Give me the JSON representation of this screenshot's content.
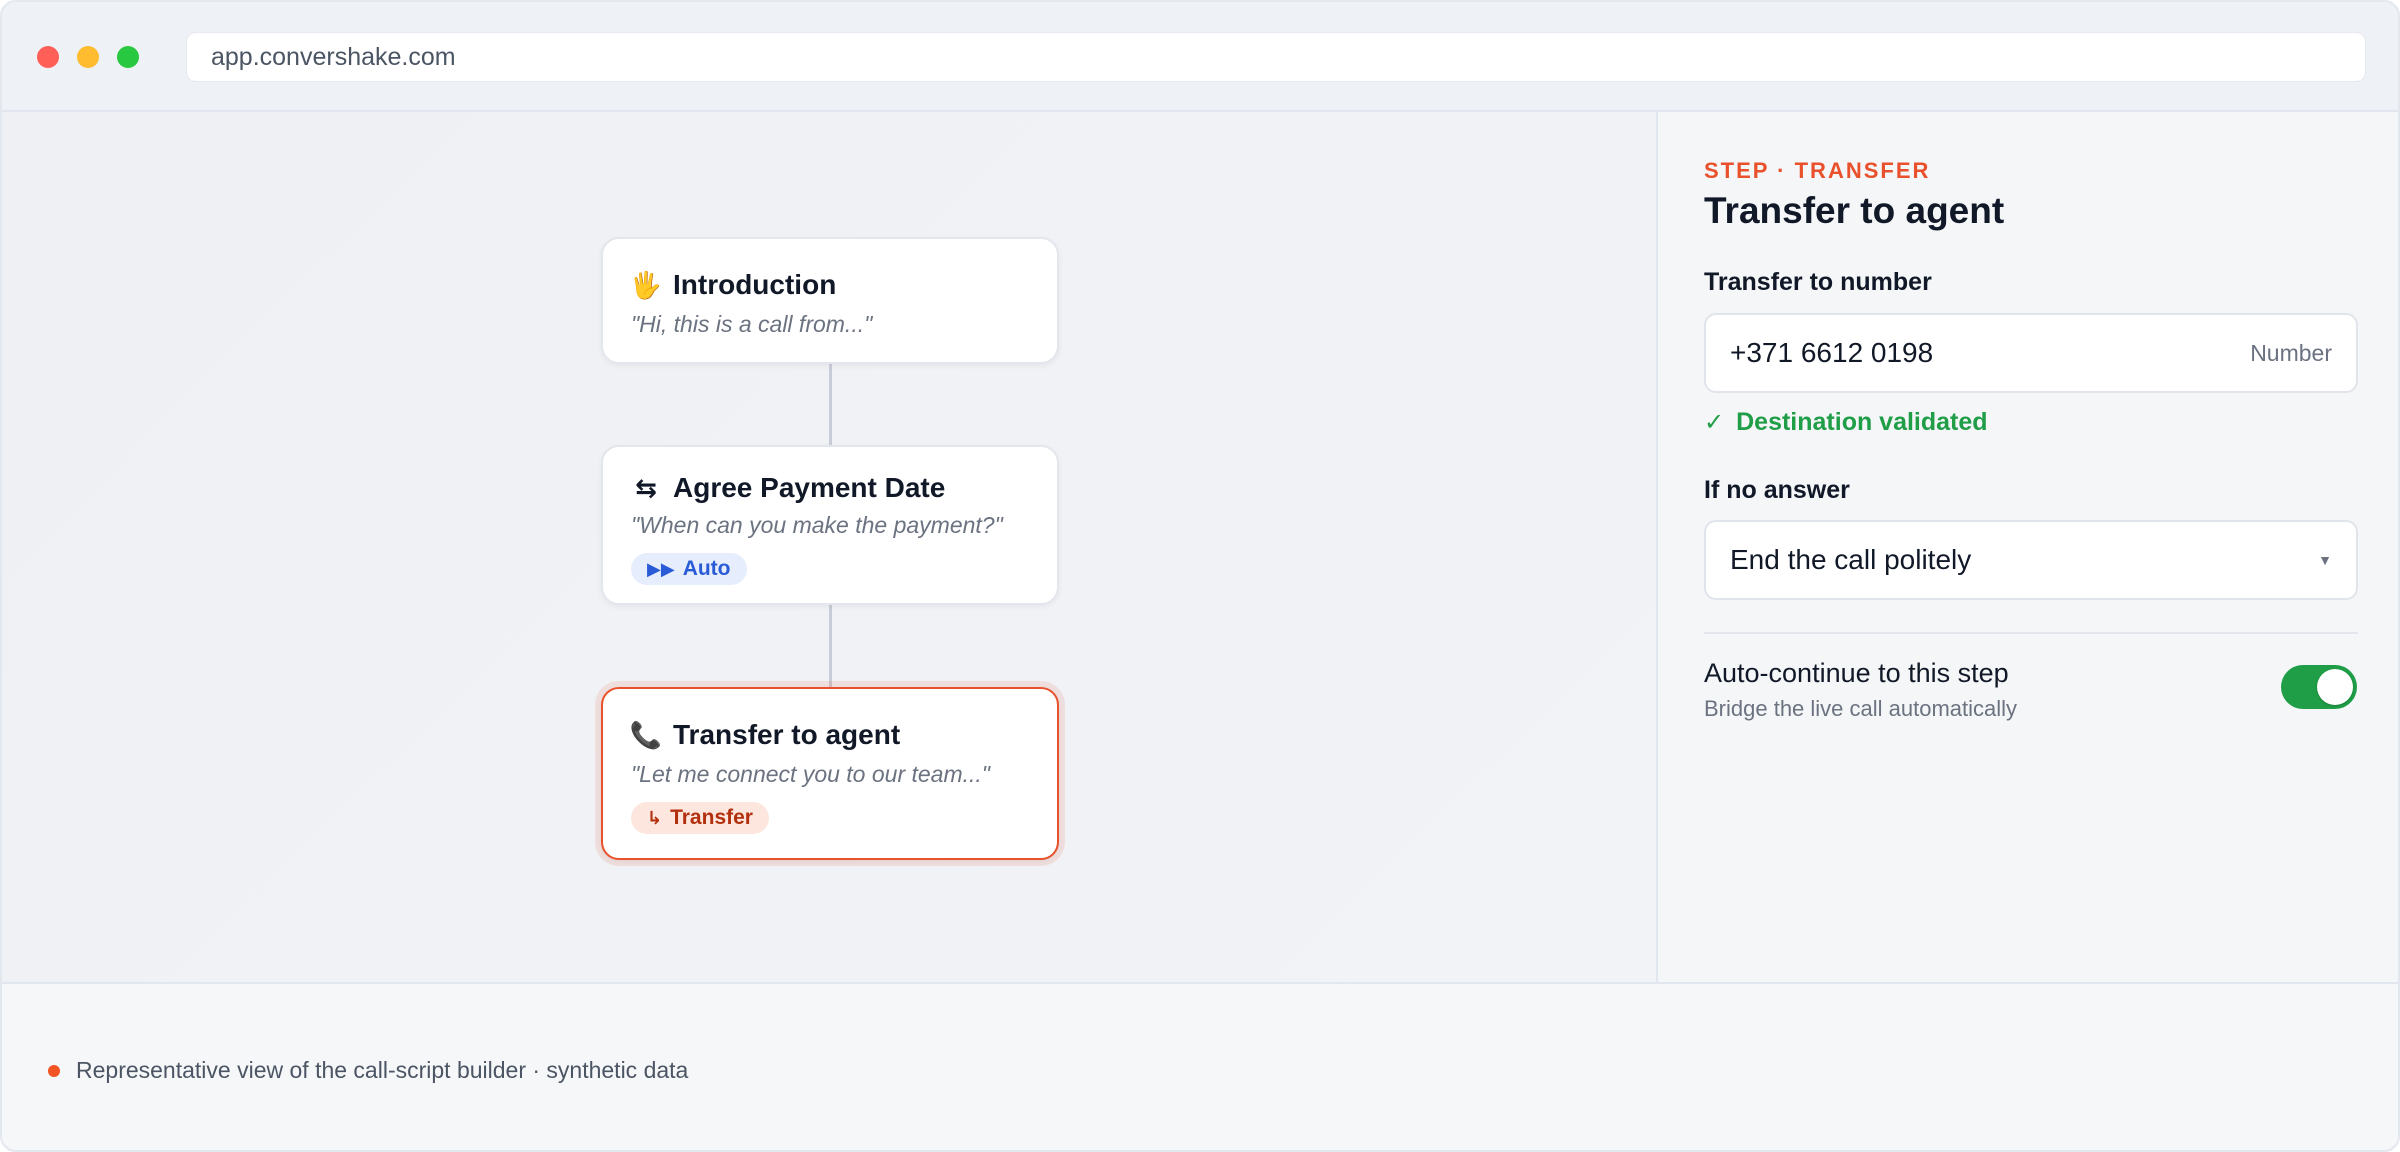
{
  "browser": {
    "url": "app.convershake.com"
  },
  "flow": {
    "nodes": [
      {
        "icon": "waving-hand-icon",
        "title": "Introduction",
        "quote": "\"Hi, this is a call from...\""
      },
      {
        "icon": "swap-arrows-icon",
        "title": "Agree Payment Date",
        "quote": "\"When can you make the payment?\"",
        "badge": "Auto",
        "badge_icon": "fast-forward-icon"
      },
      {
        "icon": "phone-icon",
        "title": "Transfer to agent",
        "quote": "\"Let me connect you to our team...\"",
        "badge": "Transfer",
        "badge_icon": "corner-arrow-icon",
        "selected": true
      }
    ]
  },
  "panel": {
    "eyebrow": "STEP · TRANSFER",
    "title": "Transfer to agent",
    "number_label": "Transfer to number",
    "number_value": "+371 6612 0198",
    "number_type": "Number",
    "validation": "Destination validated",
    "no_answer_label": "If no answer",
    "no_answer_value": "End the call politely",
    "toggle_title": "Auto-continue to this step",
    "toggle_subtitle": "Bridge the live call automatically",
    "toggle_on": true
  },
  "footer": {
    "note": "Representative view of the call-script builder · synthetic data"
  },
  "colors": {
    "accent": "#e8512b",
    "success": "#1f9d47",
    "auto_badge": "#2a5bd7"
  }
}
